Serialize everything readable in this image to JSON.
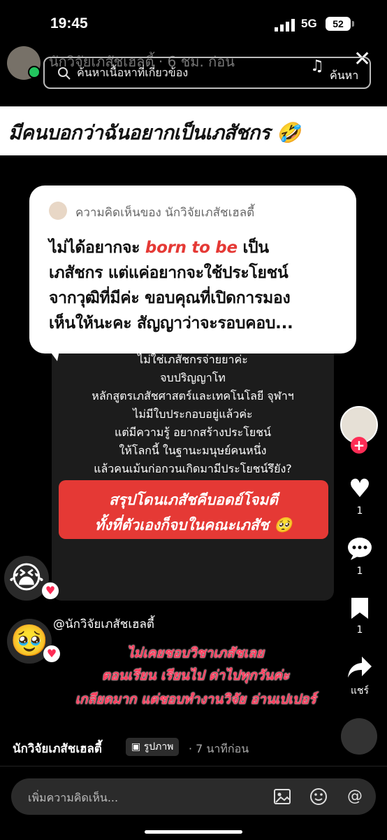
{
  "status_bar": {
    "time": "19:45",
    "network": "5G",
    "battery": "52"
  },
  "header": {
    "creator_name_behind": "นักวิจัยเภสัชเฮลตี้ · 6 ชม. ก่อน",
    "search_placeholder": "ค้นหาเนื้อหาที่เกี่ยวข้อง",
    "search_button": "ค้นหา"
  },
  "video": {
    "title_banner": "มีคนบอกว่าฉันอยากเป็นเภสัชกร 🤣",
    "bubble": {
      "header": "ความคิดเห็นของ นักวิจัยเภสัชเฮลตี้",
      "line1_a": "ไม่ได้อยากจะ ",
      "line1_red": "born to be",
      "line1_b": " เป็น",
      "line2": "เภสัชกร แต่แค่อยากจะใช้ประโยชน์",
      "line3": "จากวุฒิที่มีค่ะ ขอบคุณที่เปิดการมอง",
      "line4": "เห็นให้นะคะ สัญญาว่าจะรอบคอบ..."
    },
    "panel_lines": [
      "ไม่ใช่เภสัชกรจ่ายยาค่ะ",
      "จบปริญญาโท",
      "หลักสูตรเภสัชศาสตร์และเทคโนโลยี จุฬาฯ",
      "ไม่มีใบประกอบอยู่แล้วค่ะ",
      "แต่มีความรู้ อยากสร้างประโยชน์",
      "ให้โลกนี้ ในฐานะมนุษย์คนหนึ่ง",
      "แล้วคนเม้นก่อกวนเกิดมามีประโยชน์รึยัง?"
    ],
    "red_box": [
      "สรุปโดนเภสัชคีบอดย์โจมตี",
      "ทั้งที่ตัวเองก็จบในคณะเภสัช 🥺"
    ],
    "emoji_1": "😭",
    "emoji_2": "🥹",
    "mention": "@นักวิจัยเภสัชเฮลตี้",
    "pink_lines": [
      "ไม่เคยชอบวิชาเภสัชเลย",
      "ตอนเรียน เรียนไป ด่าไปทุกวันค่ะ",
      "เกลียดมาก แต่ชอบทำงานวิจัย อ่านเปเปอร์"
    ]
  },
  "sidebar": {
    "likes": "1",
    "comments": "1",
    "saves": "1",
    "share_label": "แชร์"
  },
  "footer": {
    "author": "นักวิจัยเภสัชเฮลตี้",
    "post_type": "รูปภาพ",
    "time_ago": "· 7 นาทีก่อน",
    "comment_placeholder": "เพิ่มความคิดเห็น..."
  }
}
